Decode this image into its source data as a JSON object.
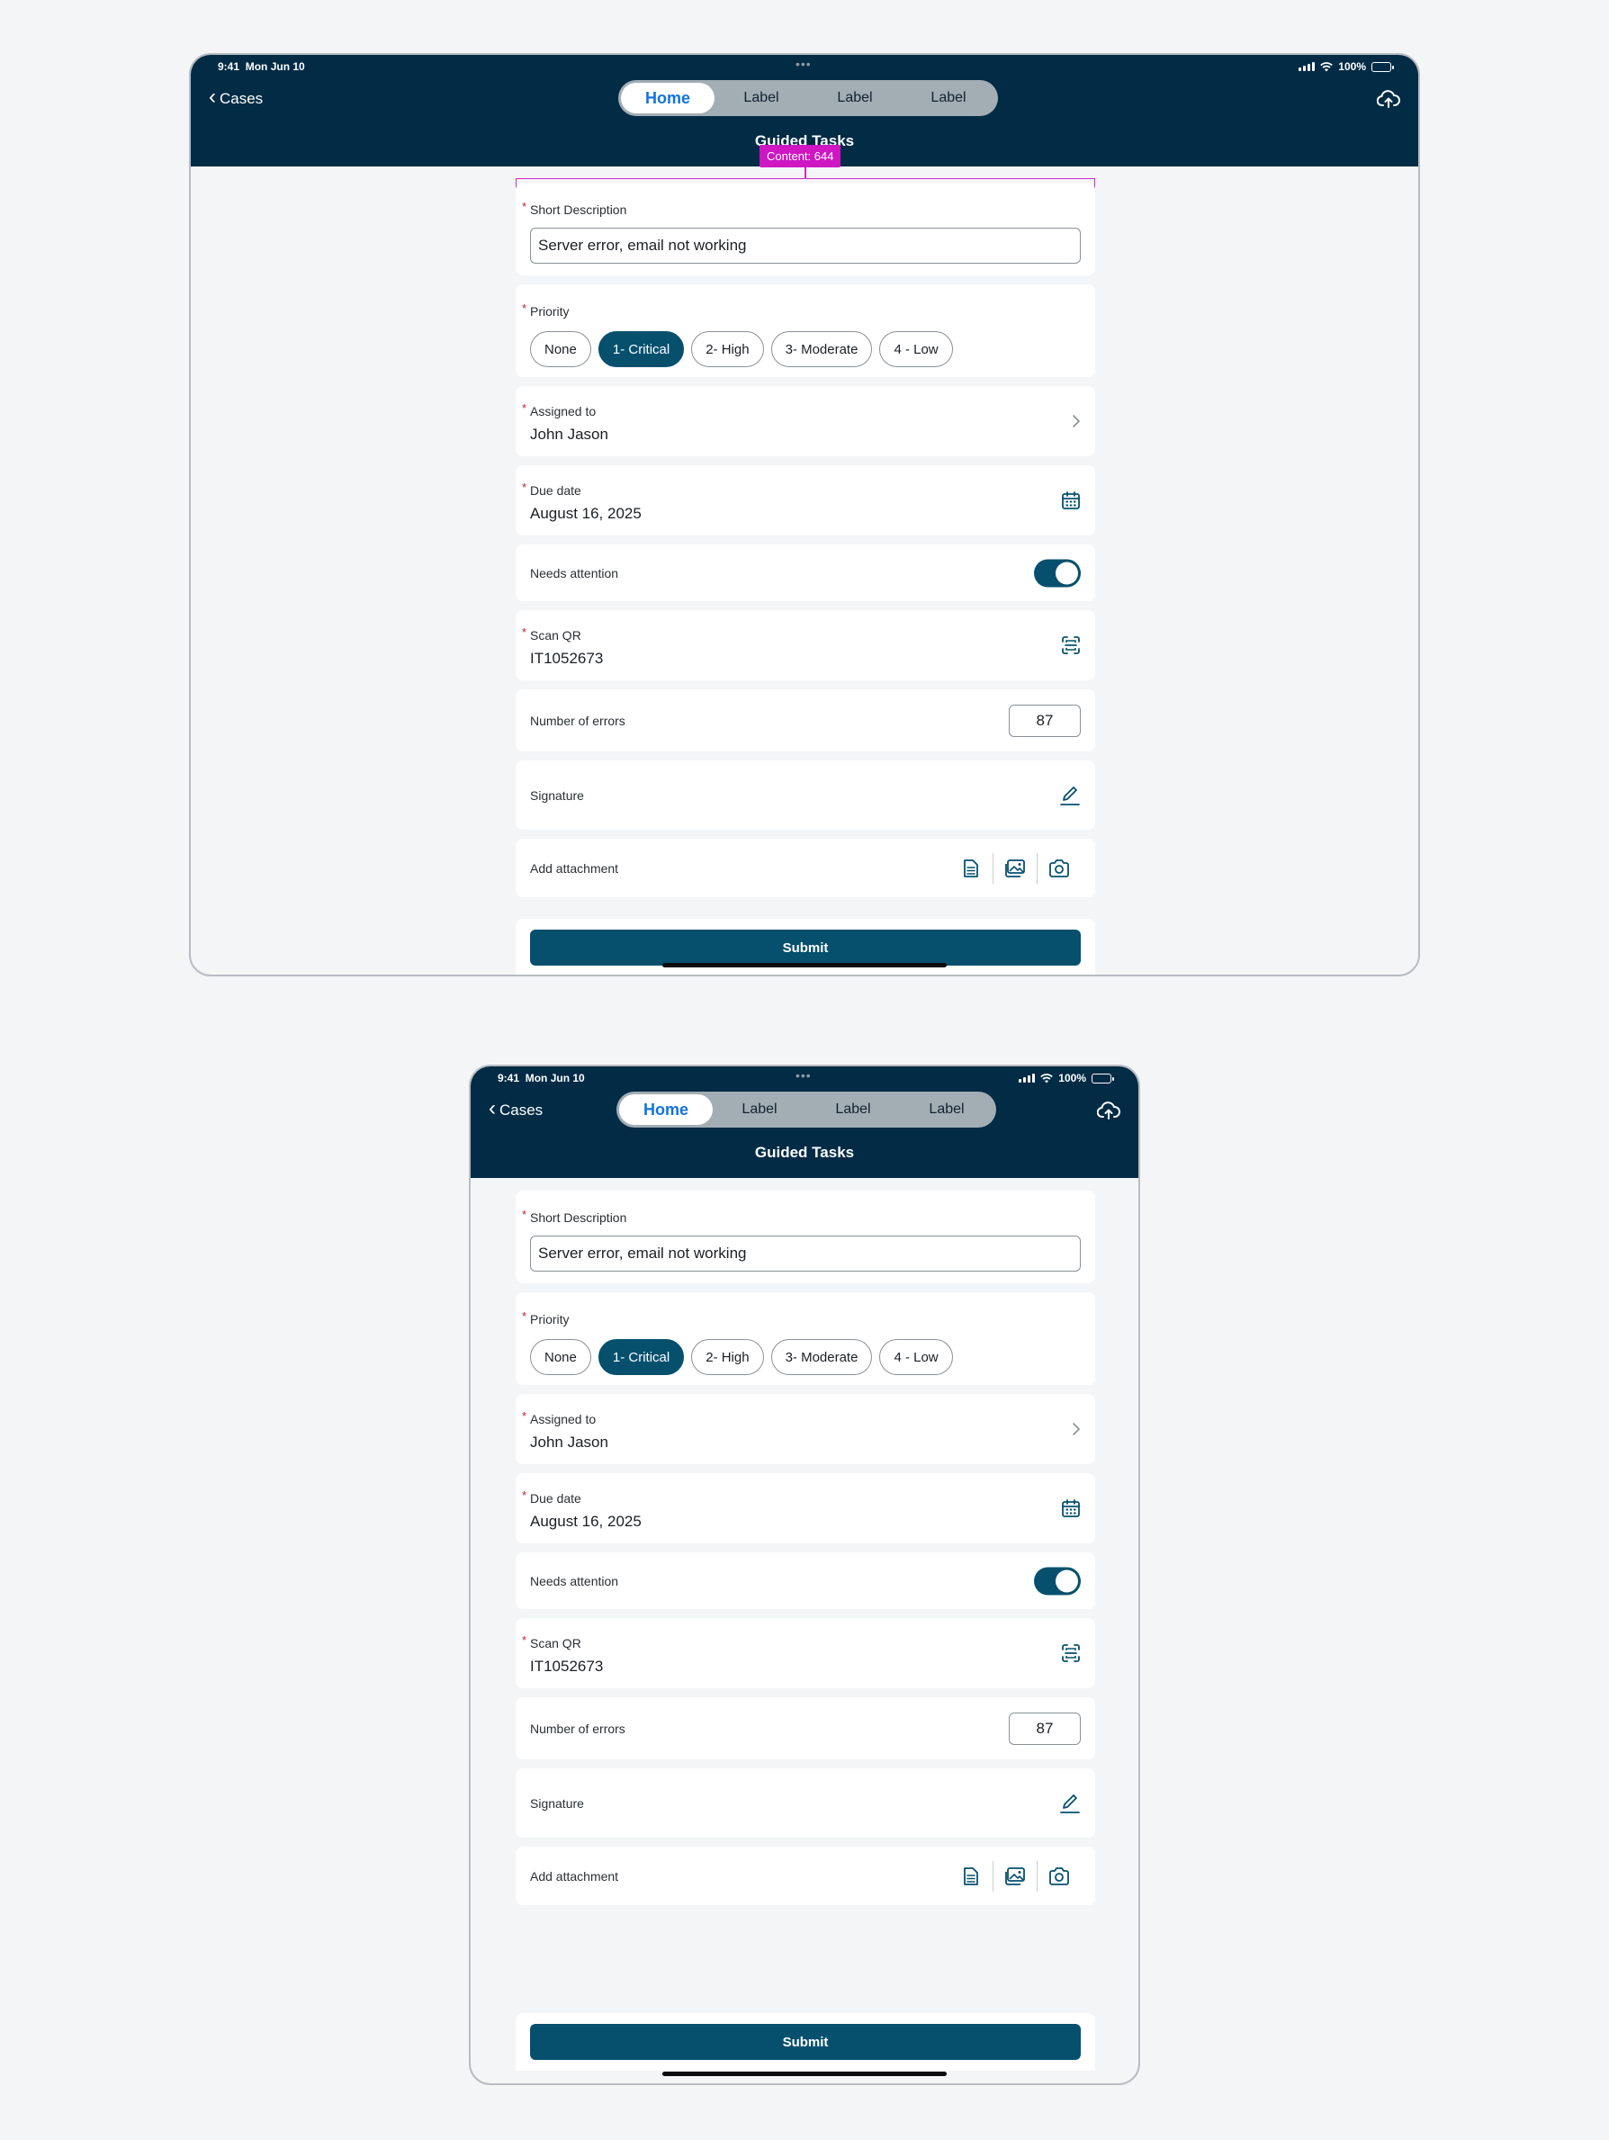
{
  "status": {
    "time": "9:41",
    "date": "Mon Jun 10",
    "battery": "100%"
  },
  "nav": {
    "back_label": "Cases",
    "tabs": [
      "Home",
      "Label",
      "Label",
      "Label"
    ],
    "active_tab": 0,
    "title": "Guided Tasks"
  },
  "overlay": {
    "label": "Content: 644"
  },
  "form": {
    "short_description": {
      "label": "Short Description",
      "value": "Server error, email not working"
    },
    "priority": {
      "label": "Priority",
      "options": [
        "None",
        "1- Critical",
        "2- High",
        "3- Moderate",
        "4 - Low"
      ],
      "selected": 1
    },
    "assigned_to": {
      "label": "Assigned to",
      "value": "John Jason"
    },
    "due_date": {
      "label": "Due date",
      "value": "August 16, 2025"
    },
    "needs_attention": {
      "label": "Needs attention",
      "on": true
    },
    "scan_qr": {
      "label": "Scan QR",
      "value": "IT1052673"
    },
    "number_of_errors": {
      "label": "Number of errors",
      "value": "87"
    },
    "signature": {
      "label": "Signature"
    },
    "add_attachment": {
      "label": "Add attachment"
    },
    "submit_label": "Submit"
  },
  "icons": {
    "back": "chevron-left-icon",
    "cloud": "cloud-upload-icon",
    "assigned": "chevron-right-icon",
    "due": "calendar-icon",
    "scan": "qr-scan-icon",
    "signature": "pencil-icon",
    "attachments": [
      "document-icon",
      "image-icon",
      "camera-icon"
    ]
  },
  "colors": {
    "header": "#022b45",
    "accent": "#06506e",
    "active_tab_text": "#1273de",
    "required": "#c71d2b",
    "overlay": "#cf16c3"
  }
}
